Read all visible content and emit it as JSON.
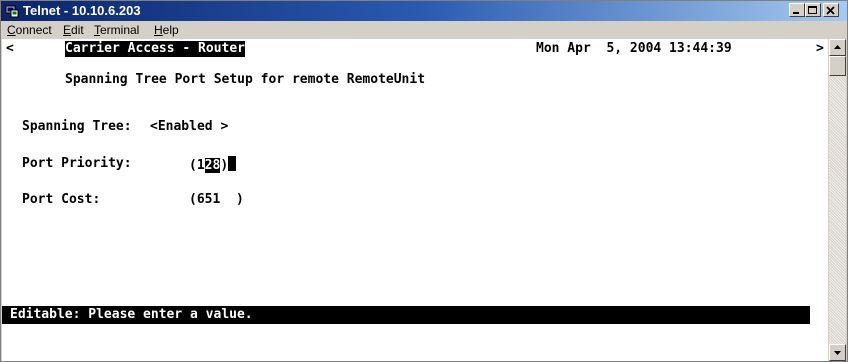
{
  "window": {
    "title": "Telnet - 10.10.6.203"
  },
  "menu": {
    "items": [
      {
        "underline": "C",
        "rest": "onnect"
      },
      {
        "underline": "E",
        "rest": "dit"
      },
      {
        "underline": "T",
        "rest": "erminal"
      },
      {
        "underline": "H",
        "rest": "elp"
      }
    ]
  },
  "terminal": {
    "left_arrow": "<",
    "right_arrow": ">",
    "header_title": "Carrier Access - Router",
    "timestamp": "Mon Apr  5, 2004 13:44:39",
    "screen_title": "Spanning Tree Port Setup for remote RemoteUnit",
    "spanning_tree_label": "Spanning Tree:",
    "spanning_tree_value": "<Enabled >",
    "port_priority_label": "Port Priority:",
    "port_priority_open": "(1",
    "port_priority_selected": "28",
    "port_priority_close": ")",
    "port_cost_label": "Port Cost:",
    "port_cost_value": "(651  )",
    "status_message": "Editable: Please enter a value."
  }
}
